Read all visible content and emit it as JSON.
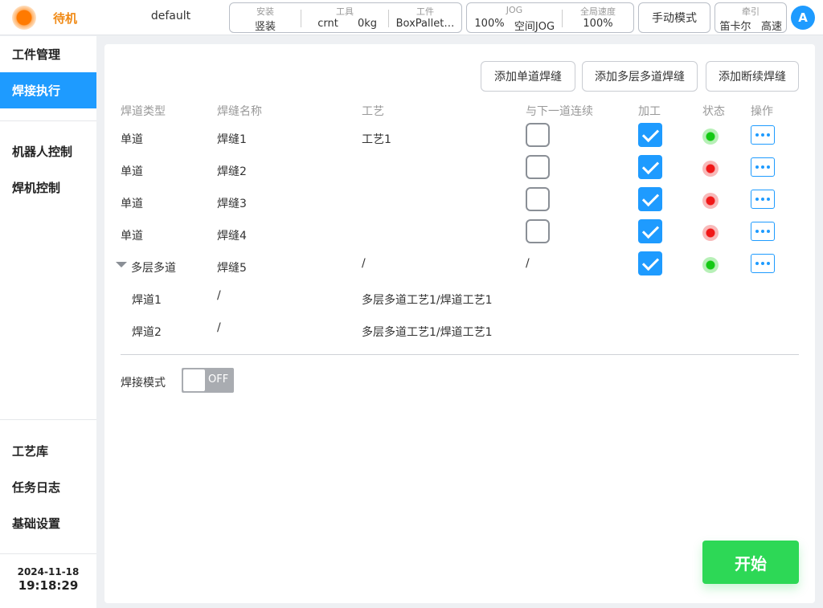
{
  "topbar": {
    "status": "待机",
    "project": "default",
    "install": {
      "caption": "安装",
      "value": "竖装"
    },
    "tool": {
      "caption": "工具",
      "name": "crnt",
      "weight": "0kg"
    },
    "workpiece": {
      "caption": "工件",
      "value": "BoxPallet…"
    },
    "jog": {
      "caption": "JOG",
      "percent": "100%",
      "mode": "空间JOG"
    },
    "global_speed": {
      "caption": "全局速度",
      "value": "100%"
    },
    "manual_mode": "手动模式",
    "traction": {
      "caption": "牵引",
      "coord": "笛卡尔",
      "speed": "高速"
    },
    "avatar": "A"
  },
  "sidebar": {
    "items": [
      {
        "label": "工件管理"
      },
      {
        "label": "焊接执行"
      },
      {
        "label": "机器人控制"
      },
      {
        "label": "焊机控制"
      },
      {
        "label": "工艺库"
      },
      {
        "label": "任务日志"
      },
      {
        "label": "基础设置"
      }
    ],
    "date": "2024-11-18",
    "time": "19:18:29"
  },
  "actions": {
    "add_single": "添加单道焊缝",
    "add_multi": "添加多层多道焊缝",
    "add_intermittent": "添加断续焊缝"
  },
  "table": {
    "headers": [
      "焊道类型",
      "焊缝名称",
      "工艺",
      "与下一道连续",
      "加工",
      "状态",
      "操作"
    ],
    "rows": [
      {
        "type": "单道",
        "name": "焊缝1",
        "process": "工艺1",
        "continuous": false,
        "process_enabled": true,
        "status": "ok"
      },
      {
        "type": "单道",
        "name": "焊缝2",
        "process": "",
        "continuous": false,
        "process_enabled": true,
        "status": "error"
      },
      {
        "type": "单道",
        "name": "焊缝3",
        "process": "",
        "continuous": false,
        "process_enabled": true,
        "status": "error"
      },
      {
        "type": "单道",
        "name": "焊缝4",
        "process": "",
        "continuous": false,
        "process_enabled": true,
        "status": "error"
      },
      {
        "type": "多层多道",
        "name": "焊缝5",
        "process": "/",
        "continuous_text": "/",
        "process_enabled": true,
        "status": "ok",
        "expanded": true
      }
    ],
    "subrows": [
      {
        "type": "焊道1",
        "name": "/",
        "process": "多层多道工艺1/焊道工艺1"
      },
      {
        "type": "焊道2",
        "name": "/",
        "process": "多层多道工艺1/焊道工艺1"
      }
    ]
  },
  "weld_mode": {
    "label": "焊接模式",
    "state": "OFF"
  },
  "start_button": "开始",
  "colors": {
    "accent": "#1e9bff",
    "status_ok": "#14c914",
    "status_error": "#f01818",
    "start": "#2dd856",
    "standby": "#f08a16"
  }
}
